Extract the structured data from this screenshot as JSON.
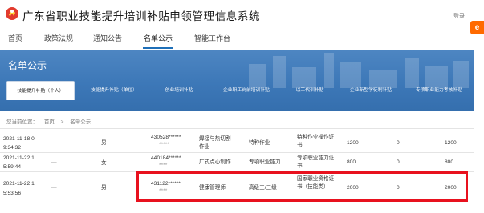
{
  "header": {
    "title": "广东省职业技能提升培训补贴申领管理信息系统",
    "login_label": "登录",
    "app_icon": "e"
  },
  "nav": {
    "items": [
      "首页",
      "政策法规",
      "通知公告",
      "名单公示",
      "智能工作台"
    ],
    "active": "名单公示"
  },
  "banner": {
    "title": "名单公示"
  },
  "tabs": [
    "技能提升补贴（个人）",
    "技能提升补贴（单位）",
    "创业培训补贴",
    "企业职工岗前培训补贴",
    "以工代训补贴",
    "企业新型学徒制补贴",
    "专项职业能力考核补贴"
  ],
  "breadcrumb": {
    "prefix": "您当前位置：",
    "home": "首页",
    "current": "名单公示"
  },
  "table": {
    "rows": [
      {
        "date": "2021-11-18 0",
        "time": "9:34:32",
        "gender": "男",
        "id": "430528******",
        "id_suffix": "*****",
        "occupation": "焊接与热切割作业",
        "category": "特种作业",
        "cert": "特种作业操作证书",
        "amount": "1200",
        "zero": "0",
        "total": "1200"
      },
      {
        "date": "2021-11-22 1",
        "time": "5:59:44",
        "gender": "女",
        "id": "440184******",
        "id_suffix": "****",
        "occupation": "广式点心制作",
        "category": "专项职业能力",
        "cert": "专项职业能力证书",
        "amount": "800",
        "zero": "0",
        "total": "800"
      },
      {
        "date": "2021-11-22 1",
        "time": "5:53:56",
        "gender": "男",
        "id": "431122******",
        "id_suffix": "****",
        "occupation": "健康管理师",
        "category": "高级工/三级",
        "cert": "国家职业资格证书（技能类）",
        "amount": "2000",
        "zero": "0",
        "total": "2000"
      }
    ]
  },
  "colors": {
    "banner": "#3d78b8",
    "nav_active": "#1e6fb8",
    "highlight": "#e8111e",
    "app_icon": "#ff6a00"
  }
}
